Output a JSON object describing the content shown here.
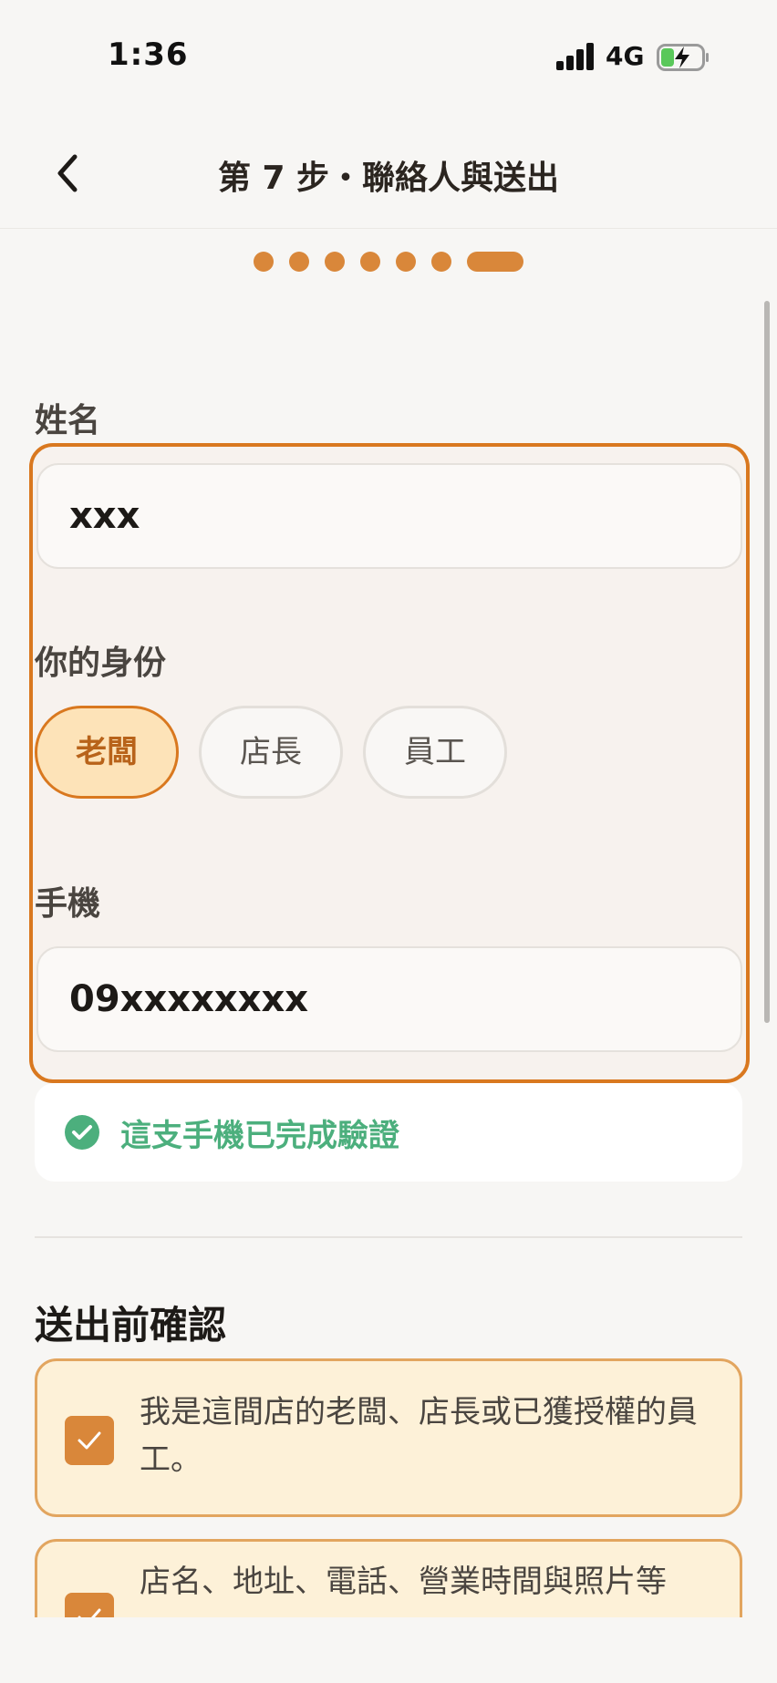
{
  "status_bar": {
    "time": "1:36",
    "network": "4G"
  },
  "header": {
    "title": "第 7 步・聯絡人與送出"
  },
  "progress": {
    "total_steps": 7,
    "current_step": 7
  },
  "form": {
    "name_label": "姓名",
    "name_value": "xxx",
    "role_label": "你的身份",
    "role_options": [
      "老闆",
      "店長",
      "員工"
    ],
    "role_selected": "老闆",
    "phone_label": "手機",
    "phone_value": "09xxxxxxxx",
    "phone_verified_text": "這支手機已完成驗證"
  },
  "confirm_section": {
    "title": "送出前確認",
    "items": [
      {
        "text": "我是這間店的老闆、店長或已獲授權的員工。",
        "checked": true
      },
      {
        "text": "店名、地址、電話、營業時間與照片等",
        "checked": true
      }
    ]
  },
  "colors": {
    "accent": "#d9781f",
    "accent_fill": "#fde3b8",
    "success": "#4caf7d",
    "card_bg": "#fdf1d8"
  }
}
